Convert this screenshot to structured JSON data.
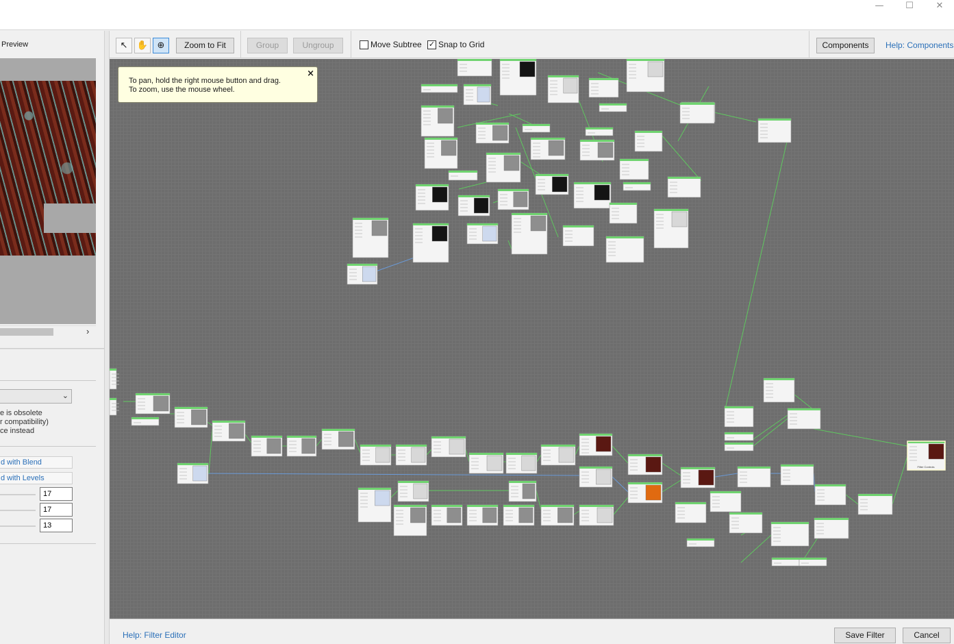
{
  "window": {
    "minimize": "—",
    "maximize": "☐",
    "close": "✕"
  },
  "preview": {
    "title": "Preview",
    "scroll_arrow": "›"
  },
  "settings": {
    "select_chevron": "⌄",
    "obsolete_lines": [
      "e is obsolete",
      "r compatibility)",
      "ce instead"
    ],
    "link_blend": "d with Blend",
    "link_levels": "d with Levels",
    "values": [
      "17",
      "17",
      "13"
    ]
  },
  "toolbar": {
    "pointer_icon": "↖",
    "hand_icon": "✋",
    "zoom_icon": "⊕",
    "zoom_to_fit": "Zoom to Fit",
    "group": "Group",
    "ungroup": "Ungroup",
    "move_subtree": {
      "label": "Move Subtree",
      "checked": false
    },
    "snap_to_grid": {
      "label": "Snap to Grid",
      "checked": true,
      "mark": "✓"
    },
    "components": "Components",
    "help_components": "Help: Components"
  },
  "canvas": {
    "tip_line1": "To pan, hold the right mouse button and drag.",
    "tip_line2": "To zoom, use the mouse wheel.",
    "tip_close": "×",
    "output_node_label": "Filter Controls"
  },
  "footer": {
    "help": "Help: Filter Editor",
    "save": "Save Filter",
    "cancel": "Cancel"
  },
  "colors": {
    "link": "#2a6fb8",
    "node_header": "#6fd36f",
    "wire": "#5fc85f",
    "canvas": "#6d6d6d"
  }
}
